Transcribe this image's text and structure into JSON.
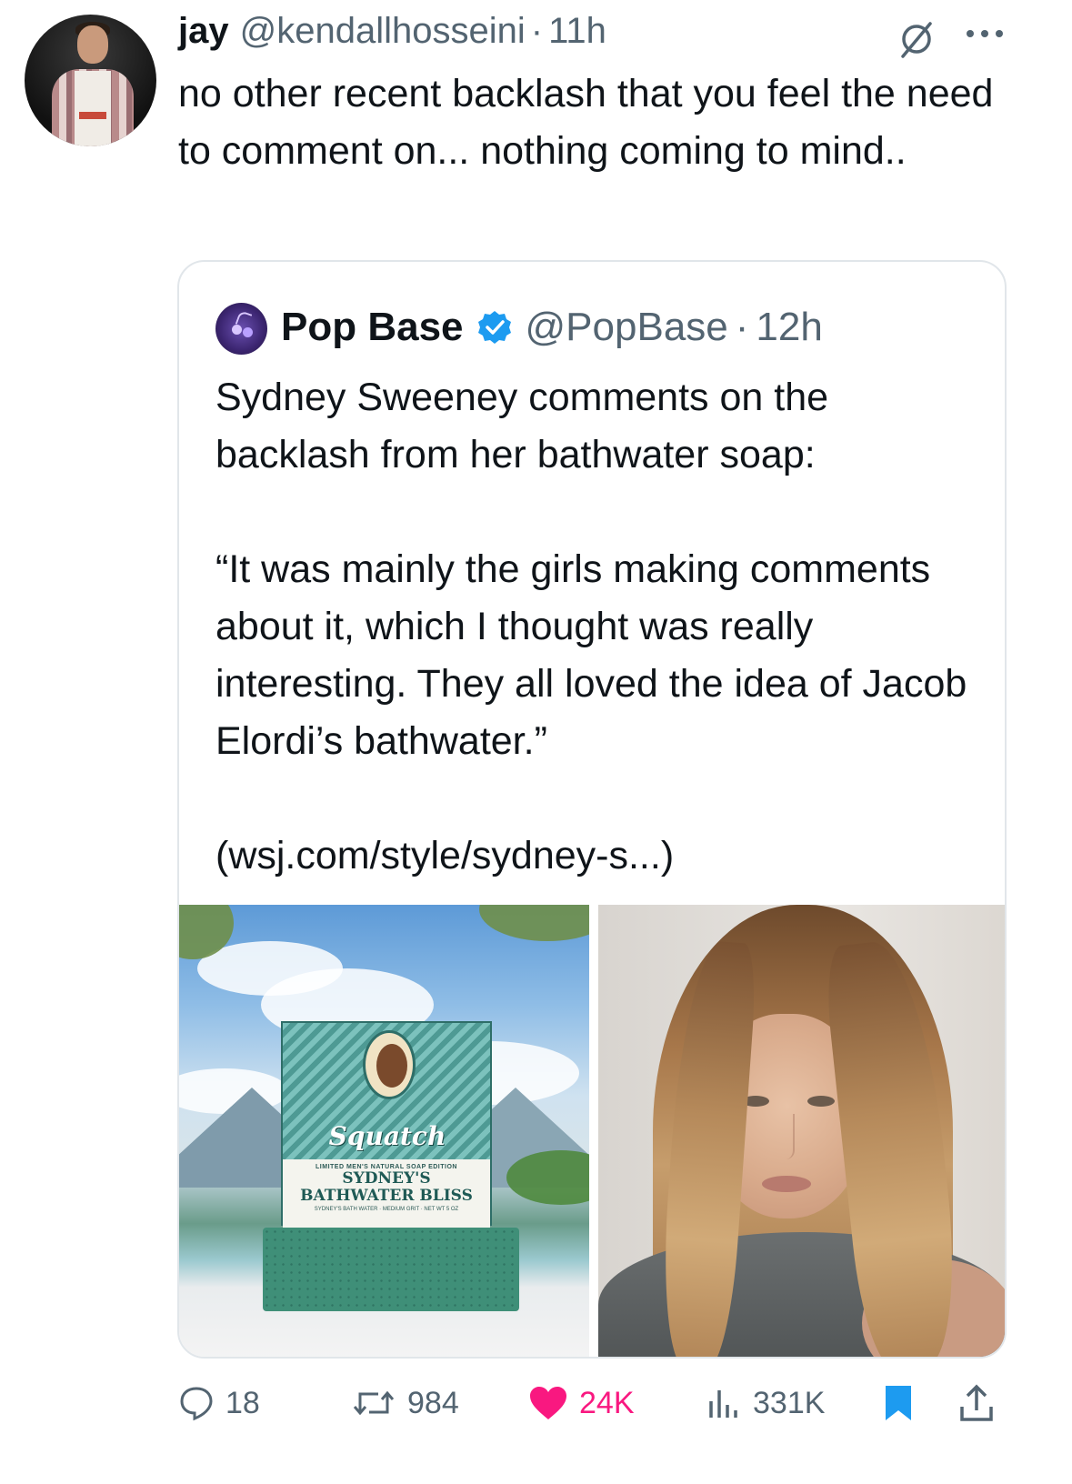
{
  "tweet": {
    "display_name": "jay",
    "handle": "@kendallhosseini",
    "separator": "·",
    "time": "11h",
    "text": "no other recent backlash that you feel the need to comment on... nothing coming to mind.."
  },
  "quote": {
    "display_name": "Pop Base",
    "handle": "@PopBase",
    "separator": "·",
    "time": "12h",
    "paragraph1": "Sydney Sweeney comments on the backlash from her bathwater soap:",
    "paragraph2": "“It was mainly the girls making comments about it, which I thought was really interesting. They all loved the idea of Jacob Elordi’s bathwater.”",
    "paragraph3": "(wsj.com/style/sydney-s...)",
    "media": {
      "left_image": {
        "logo_text": "Squatch",
        "small_text": "LIMITED   MEN'S NATURAL SOAP   EDITION",
        "product_name_line1": "SYDNEY'S",
        "product_name_line2": "BATHWATER BLISS",
        "footer_text": "SYDNEY'S BATH WATER · MEDIUM GRIT · NET WT 5 OZ"
      }
    }
  },
  "actions": {
    "replies": "18",
    "reposts": "984",
    "likes": "24K",
    "views": "331K"
  },
  "icons": {
    "reply": "reply-icon",
    "repost": "repost-icon",
    "like": "heart-icon",
    "views": "views-icon",
    "bookmark": "bookmark-icon",
    "share": "share-icon",
    "more": "more-icon",
    "grok": "slash-circle-icon",
    "verified": "verified-badge-icon"
  },
  "colors": {
    "like": "#f91880",
    "bookmark": "#1d9bf0",
    "verified": "#1d9bf0",
    "secondary_text": "#536471"
  }
}
